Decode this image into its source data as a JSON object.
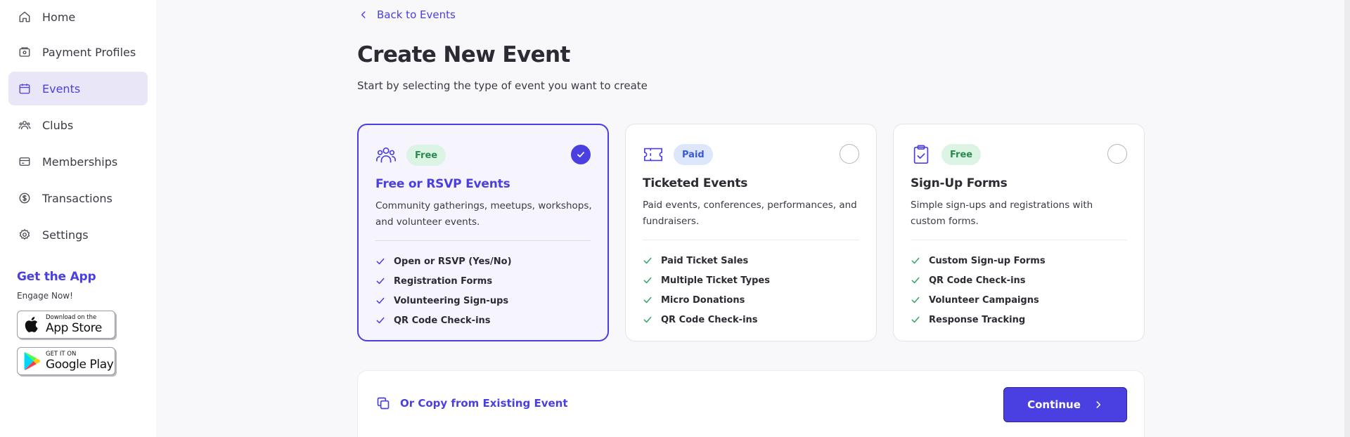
{
  "sidebar": {
    "items": [
      {
        "label": "Home",
        "icon": "home-icon"
      },
      {
        "label": "Payment Profiles",
        "icon": "wallet-icon"
      },
      {
        "label": "Events",
        "icon": "calendar-icon",
        "active": true
      },
      {
        "label": "Clubs",
        "icon": "people-group-icon"
      },
      {
        "label": "Memberships",
        "icon": "card-icon"
      },
      {
        "label": "Transactions",
        "icon": "dollar-circle-icon"
      },
      {
        "label": "Settings",
        "icon": "gear-icon"
      }
    ],
    "get_app": {
      "title": "Get the App",
      "subtitle": "Engage Now!",
      "app_store": {
        "small": "Download on the",
        "big": "App Store",
        "icon": "apple-icon"
      },
      "google_play": {
        "small": "GET IT ON",
        "big": "Google Play",
        "icon": "play-store-icon"
      }
    }
  },
  "main": {
    "back_link": "Back to Events",
    "title": "Create New Event",
    "subtitle": "Start by selecting the type of event you want to create",
    "cards": [
      {
        "badge": "Free",
        "icon": "people-icon",
        "title": "Free or RSVP Events",
        "description": "Community gatherings, meetups, workshops, and volunteer events.",
        "selected": true,
        "features": [
          "Open or RSVP (Yes/No)",
          "Registration Forms",
          "Volunteering Sign-ups",
          "QR Code Check-ins"
        ]
      },
      {
        "badge": "Paid",
        "icon": "ticket-icon",
        "title": "Ticketed Events",
        "description": "Paid events, conferences, performances, and fundraisers.",
        "selected": false,
        "features": [
          "Paid Ticket Sales",
          "Multiple Ticket Types",
          "Micro Donations",
          "QR Code Check-ins"
        ]
      },
      {
        "badge": "Free",
        "icon": "clipboard-check-icon",
        "title": "Sign-Up Forms",
        "description": "Simple sign-ups and registrations with custom forms.",
        "selected": false,
        "features": [
          "Custom Sign-up Forms",
          "QR Code Check-ins",
          "Volunteer Campaigns",
          "Response Tracking"
        ]
      }
    ],
    "copy_link": "Or Copy from Existing Event",
    "continue_label": "Continue"
  },
  "colors": {
    "accent": "#4a3fe0",
    "free_badge_bg": "#dcf4e3",
    "free_badge_text": "#2a8a4e",
    "paid_badge_bg": "#dde7fb",
    "paid_badge_text": "#3a5ad8",
    "check": "#2fa866"
  }
}
